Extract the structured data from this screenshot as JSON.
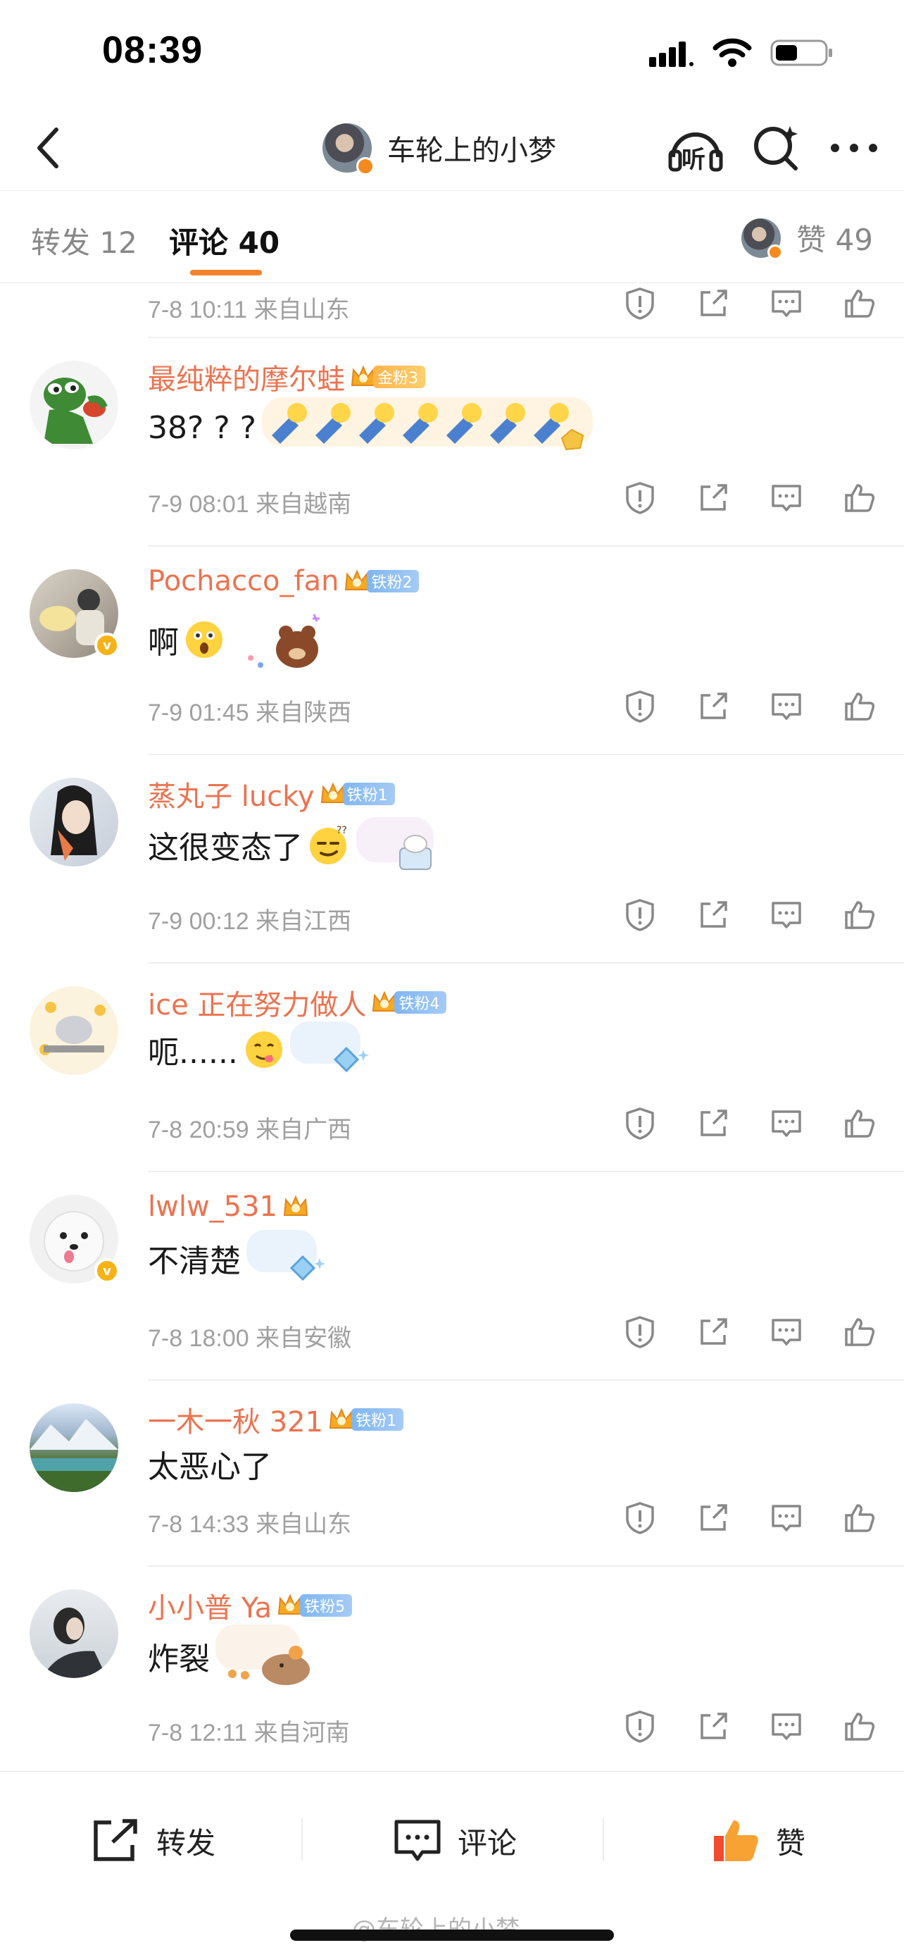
{
  "status_bar": {
    "time": "08:39",
    "icons": [
      "signal-icon",
      "wifi-icon",
      "battery-icon"
    ]
  },
  "nav": {
    "username": "车轮上的小梦",
    "listen_label": "听",
    "icons": [
      "back-icon",
      "listen-headphone-icon",
      "search-sparkle-icon",
      "more-icon"
    ]
  },
  "tabs": {
    "repost": "转发 12",
    "comment": "评论 40",
    "like": "赞 49"
  },
  "top_meta": "7-8 10:11  来自山东",
  "comments": [
    {
      "name": "最纯粹的摩尔蛙",
      "badge": "金粉3",
      "badge_type": "gold",
      "text": "38? ? ?",
      "meta": "7-9 08:01  来自越南",
      "verified": false
    },
    {
      "name": "Pochacco_fan",
      "badge": "铁粉2",
      "badge_type": "iron",
      "text": "啊",
      "meta": "7-9 01:45  来自陕西",
      "verified": true
    },
    {
      "name": "蒸丸子 lucky",
      "badge": "铁粉1",
      "badge_type": "iron",
      "text": "这很变态了",
      "meta": "7-9 00:12  来自江西",
      "verified": false
    },
    {
      "name": "ice 正在努力做人",
      "badge": "铁粉4",
      "badge_type": "iron",
      "text": "呃......",
      "meta": "7-8 20:59  来自广西",
      "verified": false
    },
    {
      "name": "lwlw_531",
      "badge": "",
      "badge_type": "crown",
      "text": "不清楚",
      "meta": "7-8 18:00  来自安徽",
      "verified": true
    },
    {
      "name": "一木一秋 321",
      "badge": "铁粉1",
      "badge_type": "iron",
      "text": "太恶心了",
      "meta": "7-8 14:33  来自山东",
      "verified": false
    },
    {
      "name": "小小普 Ya",
      "badge": "铁粉5",
      "badge_type": "iron",
      "text": "炸裂",
      "meta": "7-8 12:11  来自河南",
      "verified": false
    }
  ],
  "bottom_bar": {
    "repost": "转发",
    "comment": "评论",
    "like": "赞"
  },
  "watermark": "@车轮上的小梦",
  "colors": {
    "accent": "#f4822a",
    "name": "#eb7350",
    "meta": "#a0a0a0"
  }
}
